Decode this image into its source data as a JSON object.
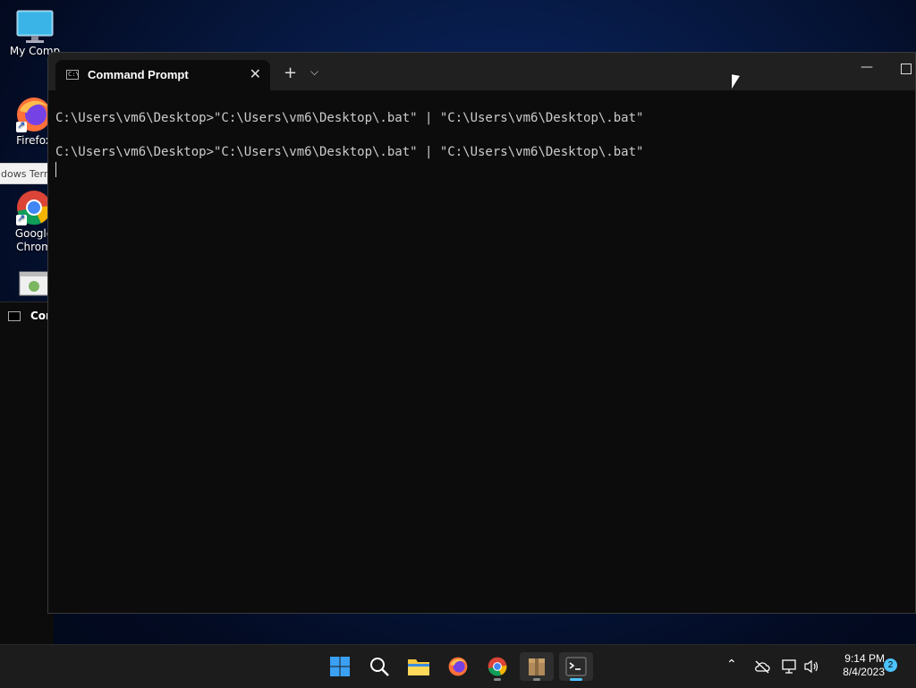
{
  "desktop": {
    "icons": [
      {
        "label": "My Comp"
      },
      {
        "label": "Firefox"
      },
      {
        "label": "Google Chrom"
      }
    ],
    "tooltip": "dows Term"
  },
  "background_window": {
    "title": "Con"
  },
  "terminal": {
    "tab_title": "Command Prompt",
    "lines": [
      "C:\\Users\\vm6\\Desktop>\"C:\\Users\\vm6\\Desktop\\.bat\" | \"C:\\Users\\vm6\\Desktop\\.bat\"",
      "",
      "C:\\Users\\vm6\\Desktop>\"C:\\Users\\vm6\\Desktop\\.bat\" | \"C:\\Users\\vm6\\Desktop\\.bat\""
    ]
  },
  "taskbar": {
    "clock_time": "9:14 PM",
    "clock_date": "8/4/2023",
    "notification_count": "2"
  },
  "colors": {
    "terminal_bg": "#0c0c0c",
    "titlebar_bg": "#202020",
    "taskbar_bg": "#1c1c1c",
    "accent": "#4cc2ff"
  }
}
